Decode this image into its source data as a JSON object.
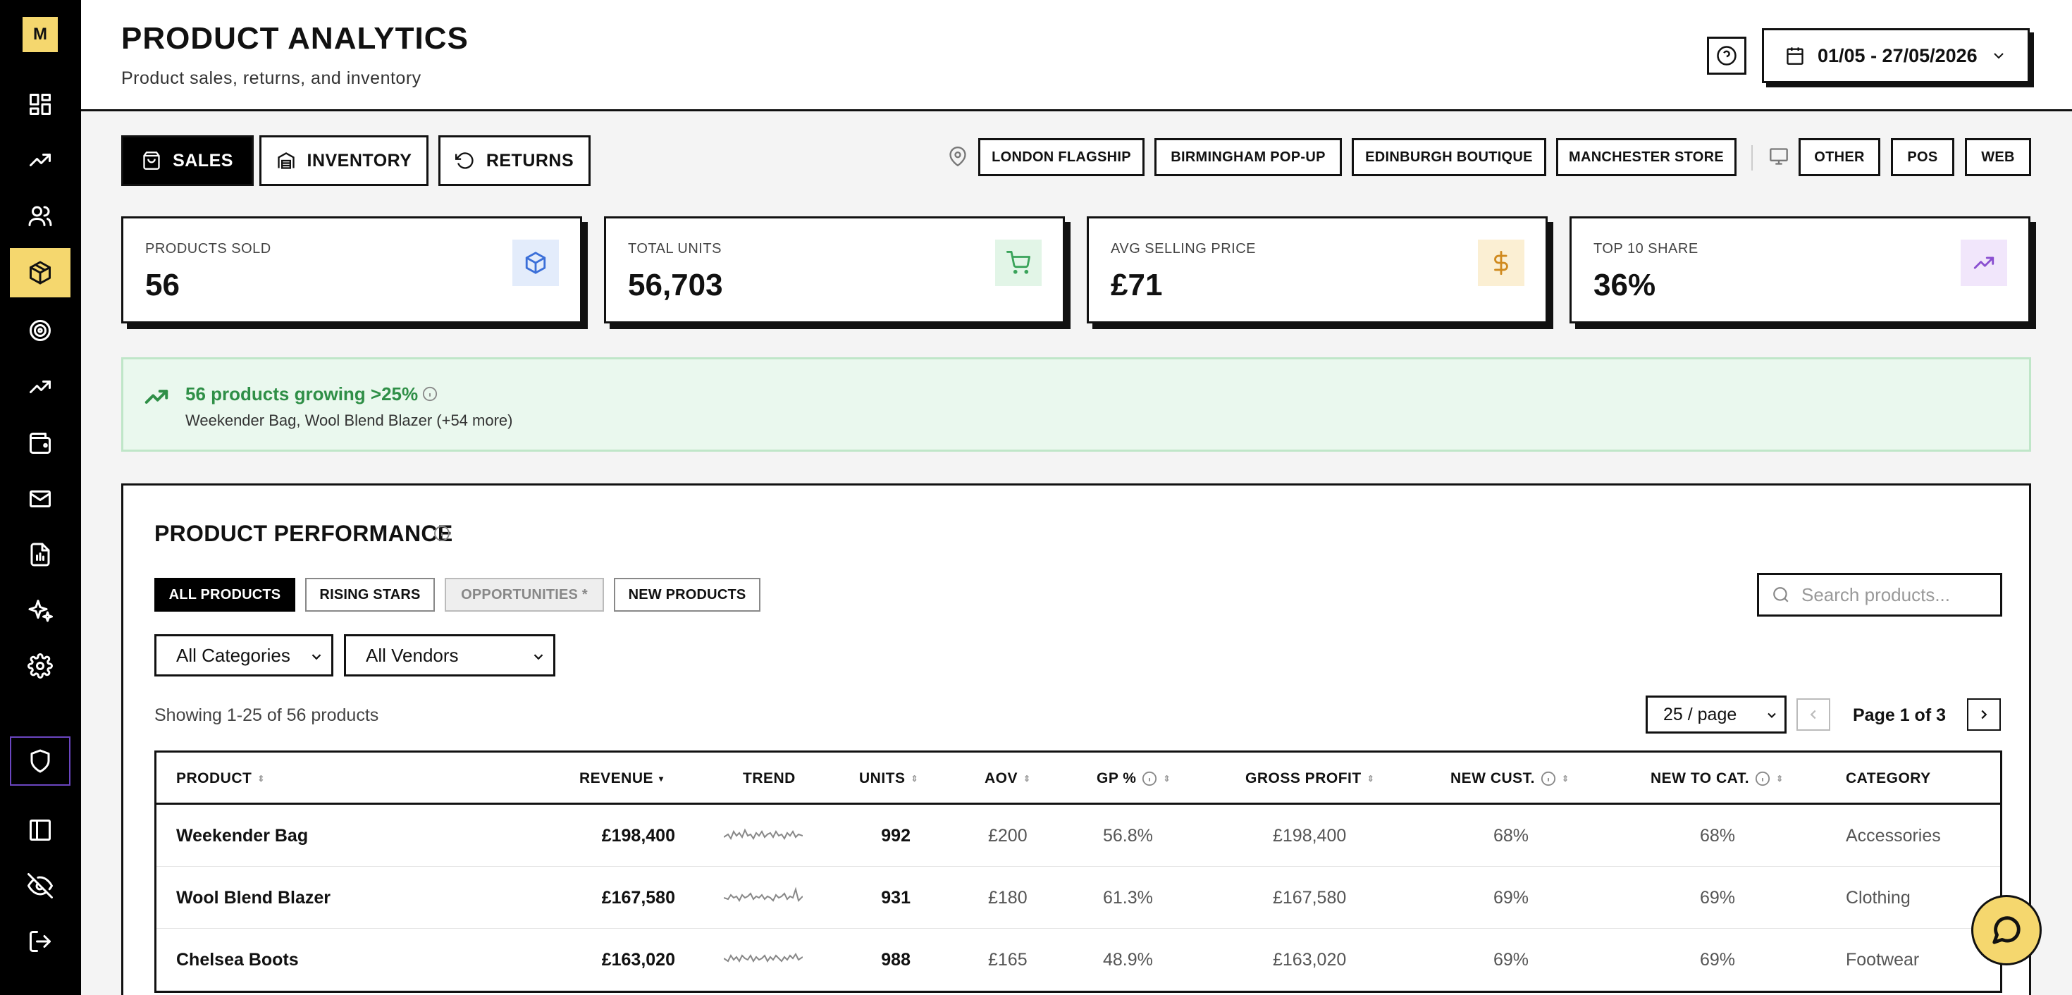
{
  "sidebar": {
    "logo": "M",
    "items": [
      {
        "icon": "dashboard-icon"
      },
      {
        "icon": "trending-up-icon"
      },
      {
        "icon": "users-icon"
      },
      {
        "icon": "package-icon",
        "active": true
      },
      {
        "icon": "target-icon"
      },
      {
        "icon": "trending-up-icon"
      },
      {
        "icon": "wallet-icon"
      },
      {
        "icon": "mail-icon"
      },
      {
        "icon": "report-icon"
      },
      {
        "icon": "sparkles-icon"
      },
      {
        "icon": "gear-icon"
      },
      {
        "icon": "shield-icon"
      },
      {
        "icon": "panel-icon"
      },
      {
        "icon": "eye-off-icon"
      },
      {
        "icon": "logout-icon"
      }
    ]
  },
  "header": {
    "title": "PRODUCT ANALYTICS",
    "subtitle": "Product sales, returns, and inventory",
    "date_range": "01/05 - 27/05/2026"
  },
  "tabs": [
    "SALES",
    "INVENTORY",
    "RETURNS"
  ],
  "locations": [
    "LONDON FLAGSHIP",
    "BIRMINGHAM POP-UP",
    "EDINBURGH BOUTIQUE",
    "MANCHESTER STORE"
  ],
  "channels": [
    "OTHER",
    "POS",
    "WEB"
  ],
  "kpis": [
    {
      "label": "PRODUCTS SOLD",
      "value": "56",
      "icon": "box-icon",
      "color": "#3b6fd8",
      "bg": "#e3ecfb"
    },
    {
      "label": "TOTAL UNITS",
      "value": "56,703",
      "icon": "cart-icon",
      "color": "#3aa35a",
      "bg": "#e2f5e7"
    },
    {
      "label": "AVG SELLING PRICE",
      "value": "£71",
      "icon": "dollar-icon",
      "color": "#d08a1e",
      "bg": "#fbefd3"
    },
    {
      "label": "TOP 10 SHARE",
      "value": "36%",
      "icon": "trending-up-icon",
      "color": "#8a4fd0",
      "bg": "#f1e6fb"
    }
  ],
  "banner": {
    "title": "56 products growing >25%",
    "subtitle": "Weekender Bag, Wool Blend Blazer (+54 more)"
  },
  "performance": {
    "title": "PRODUCT PERFORMANCE",
    "filters": [
      "ALL PRODUCTS",
      "RISING STARS",
      "OPPORTUNITIES *",
      "NEW PRODUCTS"
    ],
    "search_placeholder": "Search products...",
    "category_select": "All Categories",
    "vendor_select": "All Vendors",
    "showing": "Showing 1-25 of 56 products",
    "per_page": "25 / page",
    "page_info": "Page 1 of 3",
    "columns": [
      "PRODUCT",
      "REVENUE",
      "TREND",
      "UNITS",
      "AOV",
      "GP %",
      "GROSS PROFIT",
      "NEW CUST.",
      "NEW TO CAT.",
      "CATEGORY"
    ],
    "rows": [
      {
        "product": "Weekender Bag",
        "revenue": "£198,400",
        "units": "992",
        "aov": "£200",
        "gp": "56.8%",
        "gross_profit": "£198,400",
        "new_cust": "68%",
        "new_cat": "68%",
        "category": "Accessories"
      },
      {
        "product": "Wool Blend Blazer",
        "revenue": "£167,580",
        "units": "931",
        "aov": "£180",
        "gp": "61.3%",
        "gross_profit": "£167,580",
        "new_cust": "69%",
        "new_cat": "69%",
        "category": "Clothing"
      },
      {
        "product": "Chelsea Boots",
        "revenue": "£163,020",
        "units": "988",
        "aov": "£165",
        "gp": "48.9%",
        "gross_profit": "£163,020",
        "new_cust": "69%",
        "new_cat": "69%",
        "category": "Footwear"
      }
    ]
  }
}
